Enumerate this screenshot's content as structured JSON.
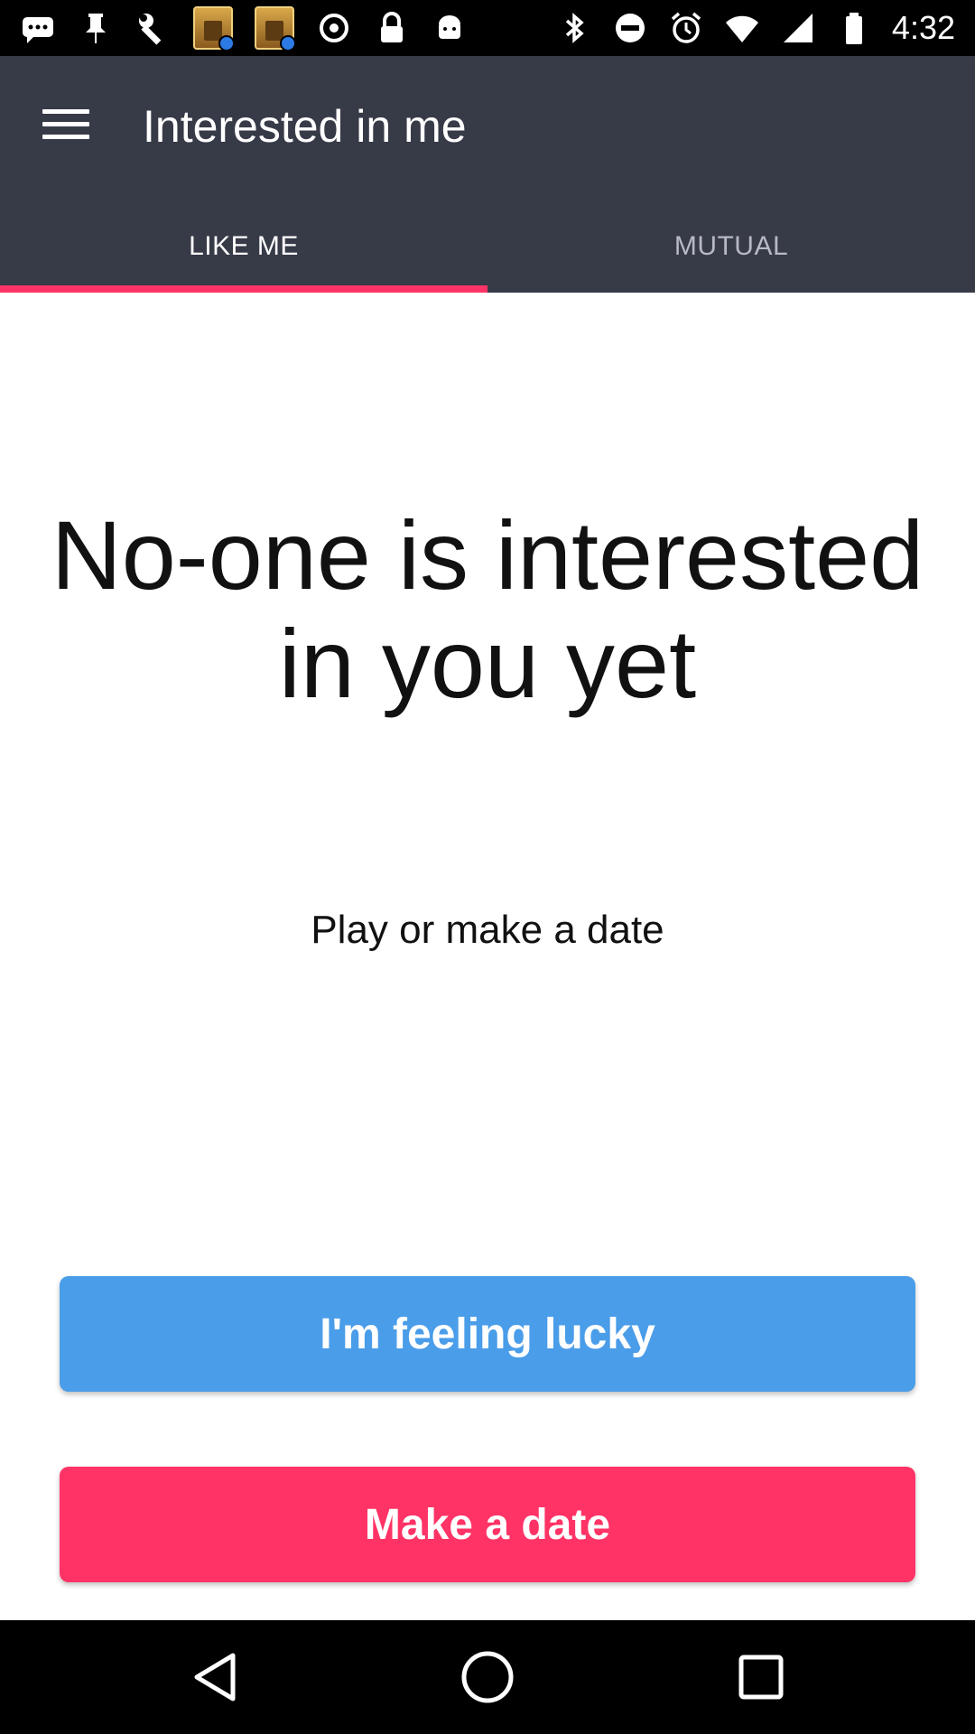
{
  "status_bar": {
    "time": "4:32",
    "left_icons": [
      "chat-icon",
      "pin-icon",
      "wrench-icon",
      "topics-app-icon",
      "topics-app-icon",
      "sync-icon",
      "lock-icon",
      "android-icon"
    ],
    "right_icons": [
      "bluetooth-icon",
      "do-not-disturb-icon",
      "alarm-icon",
      "wifi-icon",
      "signal-icon",
      "battery-icon"
    ]
  },
  "app_bar": {
    "title": "Interested in me",
    "menu_icon": "hamburger-menu-icon",
    "background": "#373a47"
  },
  "tabs": [
    {
      "label": "LIKE ME",
      "active": true
    },
    {
      "label": "MUTUAL",
      "active": false
    }
  ],
  "tab_indicator_color": "#ff3366",
  "main": {
    "headline": "No-one is interested in you yet",
    "subtext": "Play or make a date"
  },
  "buttons": {
    "lucky": {
      "label": "I'm feeling lucky",
      "color": "#4a9de9"
    },
    "make_date": {
      "label": "Make a date",
      "color": "#ff3366"
    }
  },
  "nav_bar": {
    "icons": [
      "back-icon",
      "home-icon",
      "recents-icon"
    ]
  }
}
